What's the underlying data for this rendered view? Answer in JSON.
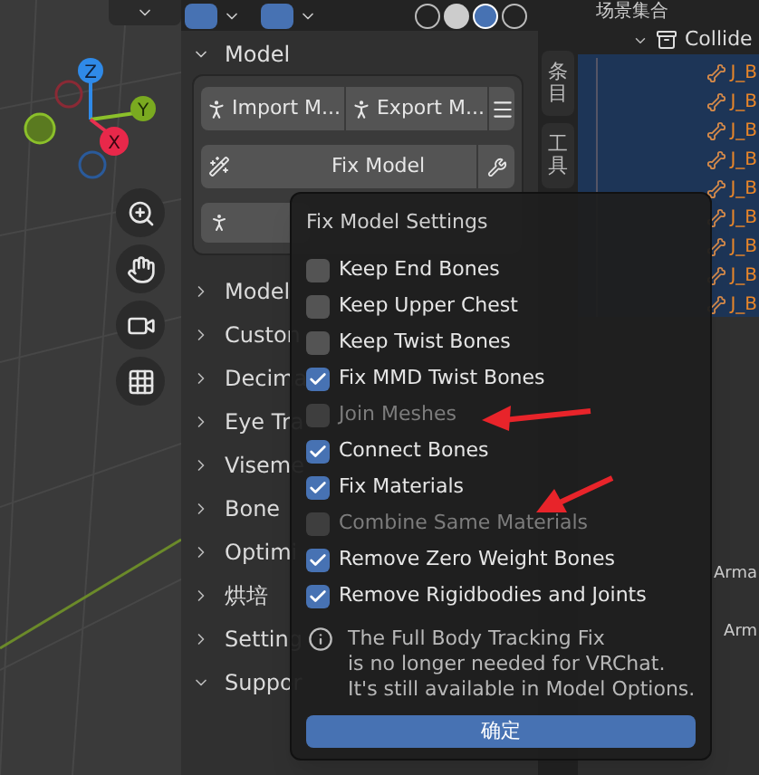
{
  "gizmo": {
    "axes": [
      "Z",
      "Y",
      "X"
    ]
  },
  "sidebar": {
    "section": "Model",
    "import_button": "Import M...",
    "export_button": "Export M...",
    "fix_button": "Fix Model",
    "collapsed_sections": [
      "Model",
      "Custon",
      "Decima",
      "Eye Tra",
      "Viseme",
      "Bone",
      "Optimi",
      "烘培",
      "Setting"
    ],
    "expanded_section": "Suppor",
    "tabs": [
      {
        "label": "条目",
        "selected": false
      },
      {
        "label": "工具",
        "selected": false
      }
    ]
  },
  "outliner": {
    "scene": "场景集合",
    "collection": "Collide",
    "items": [
      "J_B",
      "J_B",
      "J_B",
      "J_B",
      "J_B",
      "J_B",
      "J_B",
      "J_B",
      "J_B"
    ]
  },
  "properties": {
    "rows": [
      "Arma",
      "Arm"
    ]
  },
  "dialog": {
    "title": "Fix Model Settings",
    "options": [
      {
        "label": "Keep End Bones",
        "checked": false,
        "disabled": false
      },
      {
        "label": "Keep Upper Chest",
        "checked": false,
        "disabled": false
      },
      {
        "label": "Keep Twist Bones",
        "checked": false,
        "disabled": false
      },
      {
        "label": "Fix MMD Twist Bones",
        "checked": true,
        "disabled": false
      },
      {
        "label": "Join Meshes",
        "checked": false,
        "disabled": true
      },
      {
        "label": "Connect Bones",
        "checked": true,
        "disabled": false
      },
      {
        "label": "Fix Materials",
        "checked": true,
        "disabled": false
      },
      {
        "label": "Combine Same Materials",
        "checked": false,
        "disabled": true
      },
      {
        "label": "Remove Zero Weight Bones",
        "checked": true,
        "disabled": false
      },
      {
        "label": "Remove Rigidbodies and Joints",
        "checked": true,
        "disabled": false
      }
    ],
    "info": [
      "The Full Body Tracking Fix",
      "is no longer needed for VRChat.",
      "It's still available in Model Options."
    ],
    "ok_button": "确定"
  }
}
